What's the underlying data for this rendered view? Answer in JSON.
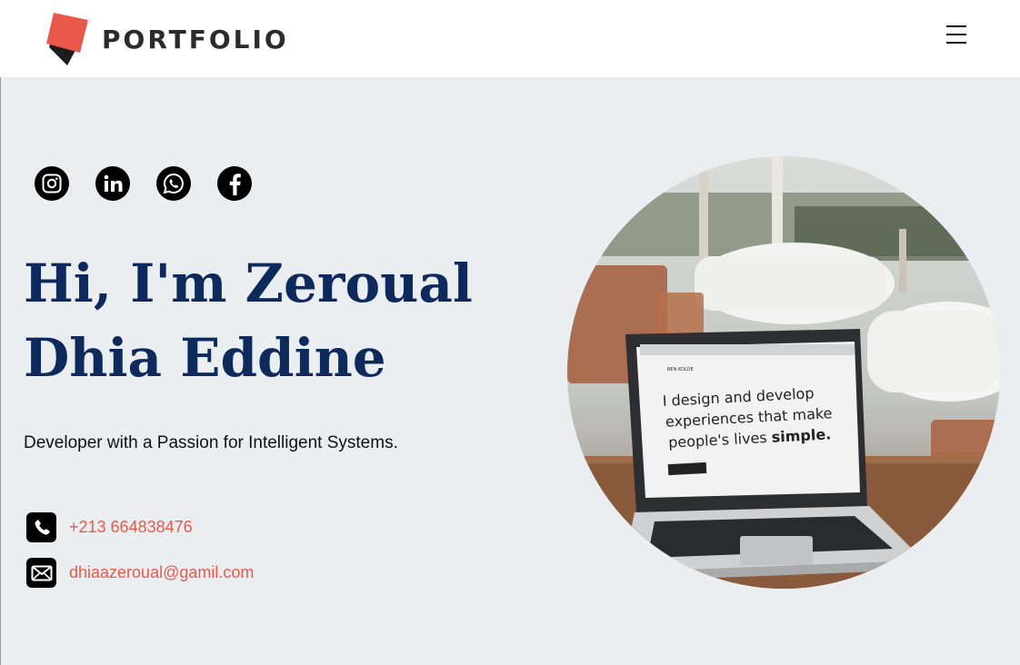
{
  "header": {
    "brand": "PORTFOLIO",
    "menu_icon": "hamburger-menu-icon",
    "accent": "#e8594a"
  },
  "hero": {
    "socials": [
      {
        "name": "instagram-icon"
      },
      {
        "name": "linkedin-icon"
      },
      {
        "name": "whatsapp-icon"
      },
      {
        "name": "facebook-icon"
      }
    ],
    "heading_line1": "Hi, I'm Zeroual",
    "heading_line2": "Dhia Eddine",
    "tagline": "Developer with a Passion for Intelligent Systems.",
    "phone": "+213 664838476",
    "email": "dhiaazeroual@gamil.com",
    "photo": {
      "screen_line1": "I design and develop",
      "screen_line2": "experiences that make",
      "screen_line3_a": "people's lives ",
      "screen_line3_b": "simple.",
      "screen_brand": "BEN KOLDE"
    }
  },
  "colors": {
    "heading": "#0e2a5c",
    "hero_bg": "#ebeef0",
    "link": "#e8594a"
  }
}
